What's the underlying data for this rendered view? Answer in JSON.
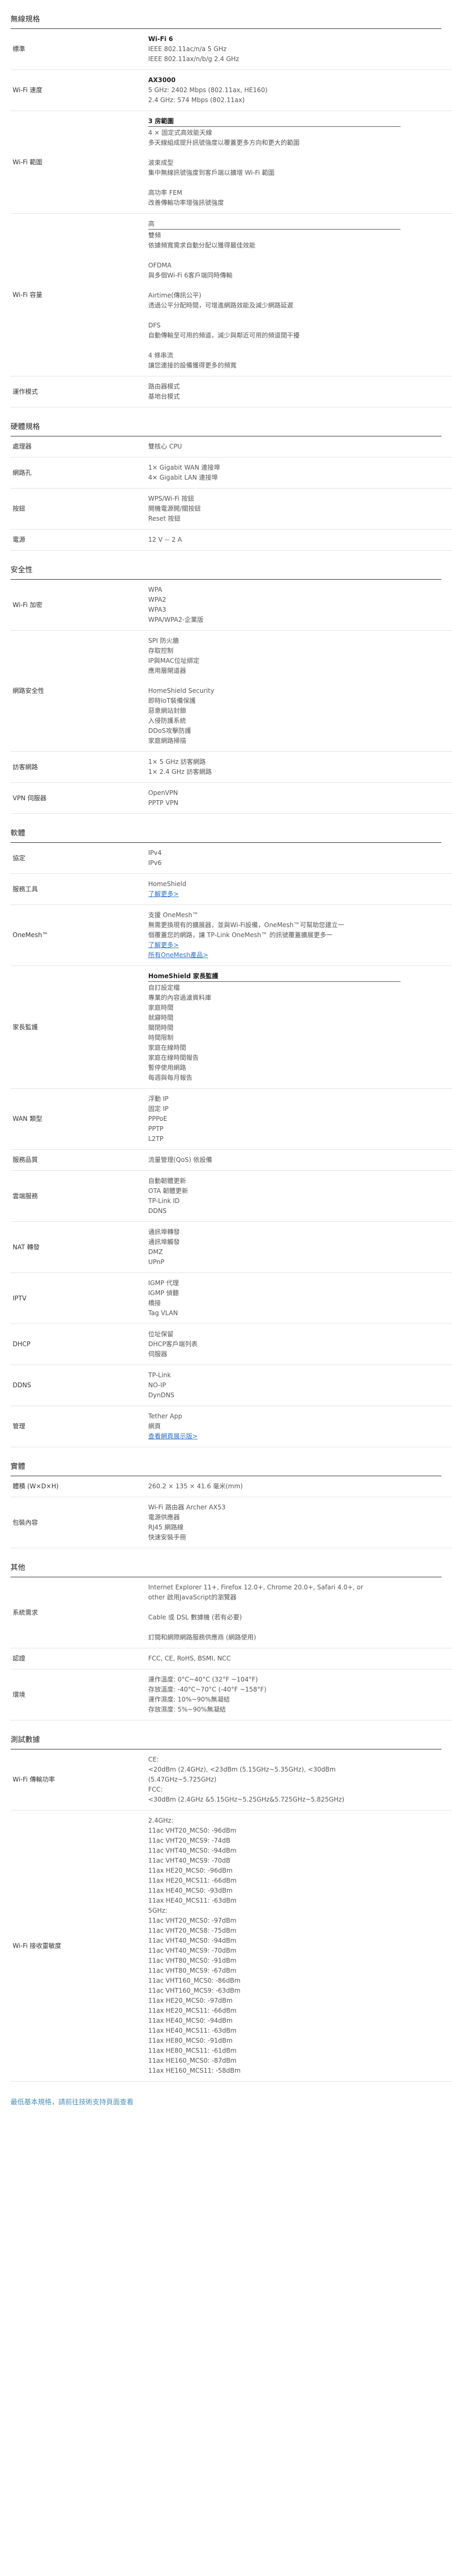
{
  "sections": [
    {
      "title": "無線規格",
      "rows": [
        {
          "key": "標準",
          "lines": [
            {
              "t": "Wi-Fi 6",
              "b": true
            },
            {
              "t": "IEEE 802.11ac/n/a 5 GHz"
            },
            {
              "t": "IEEE 802.11ax/n/b/g 2.4 GHz"
            }
          ]
        },
        {
          "key": "Wi-Fi 速度",
          "lines": [
            {
              "t": "AX3000",
              "b": true
            },
            {
              "t": "5 GHz: 2402 Mbps (802.11ax, HE160)"
            },
            {
              "t": "2.4 GHz: 574 Mbps (802.11ax)"
            }
          ]
        },
        {
          "key": "Wi-Fi 範圍",
          "lines": [
            {
              "t": "3 房範圍",
              "b": true,
              "u": true
            },
            {
              "t": "4 × 固定式高效能天線"
            },
            {
              "t": "多天線組成提升訊號強度以覆蓋更多方向和更大的範圍"
            },
            {
              "t": ""
            },
            {
              "t": "波束成型"
            },
            {
              "t": "集中無線訊號強度到客戶端以擴增 Wi-Fi 範圍"
            },
            {
              "t": ""
            },
            {
              "t": "高功率 FEM"
            },
            {
              "t": "改善傳輸功率增強訊號強度"
            }
          ]
        },
        {
          "key": "Wi-Fi 容量",
          "lines": [
            {
              "t": "高",
              "u": true
            },
            {
              "t": "雙頻"
            },
            {
              "t": "依據頻寬需求自動分配以獲得最佳效能"
            },
            {
              "t": ""
            },
            {
              "t": "OFDMA"
            },
            {
              "t": "與多個Wi-Fi 6客戶端同時傳輸"
            },
            {
              "t": ""
            },
            {
              "t": "Airtime(傳訊公平)"
            },
            {
              "t": "透過公平分配時間，可增進網路效能及減少網路延遲"
            },
            {
              "t": ""
            },
            {
              "t": "DFS"
            },
            {
              "t": "自動傳輸至可用的頻道，減少與鄰近可用的頻道間干擾"
            },
            {
              "t": ""
            },
            {
              "t": "4 條串流"
            },
            {
              "t": "讓您連接的設備獲得更多的頻寬"
            }
          ]
        },
        {
          "key": "運作模式",
          "lines": [
            {
              "t": "路由器模式"
            },
            {
              "t": "基地台模式"
            }
          ]
        }
      ]
    },
    {
      "title": "硬體規格",
      "rows": [
        {
          "key": "處理器",
          "lines": [
            {
              "t": "雙核心 CPU"
            }
          ]
        },
        {
          "key": "網路孔",
          "lines": [
            {
              "t": "1× Gigabit WAN 連接埠"
            },
            {
              "t": "4× Gigabit LAN 連接埠"
            }
          ]
        },
        {
          "key": "按鈕",
          "lines": [
            {
              "t": "WPS/Wi-Fi 按鈕"
            },
            {
              "t": "開機電源開/關按鈕"
            },
            {
              "t": "Reset 按鈕"
            }
          ]
        },
        {
          "key": "電源",
          "lines": [
            {
              "t": "12 V ⎓ 2 A"
            }
          ]
        }
      ]
    },
    {
      "title": "安全性",
      "rows": [
        {
          "key": "Wi-Fi 加密",
          "lines": [
            {
              "t": "WPA"
            },
            {
              "t": "WPA2"
            },
            {
              "t": "WPA3"
            },
            {
              "t": "WPA/WPA2-企業版"
            }
          ]
        },
        {
          "key": "網路安全性",
          "lines": [
            {
              "t": "SPI 防火牆"
            },
            {
              "t": "存取控制"
            },
            {
              "t": "IP與MAC位址綁定"
            },
            {
              "t": "應用層閘道器"
            },
            {
              "t": ""
            },
            {
              "t": "HomeShield Security"
            },
            {
              "t": "即時IoT裝備保護"
            },
            {
              "t": "惡意網站封鎖"
            },
            {
              "t": "入侵防護系統"
            },
            {
              "t": "DDoS攻擊防護"
            },
            {
              "t": "家庭網路掃描"
            }
          ]
        },
        {
          "key": "訪客網路",
          "lines": [
            {
              "t": "1× 5 GHz 訪客網路"
            },
            {
              "t": "1× 2.4 GHz 訪客網路"
            }
          ]
        },
        {
          "key": "VPN 伺服器",
          "lines": [
            {
              "t": "OpenVPN"
            },
            {
              "t": "PPTP VPN"
            }
          ]
        }
      ]
    },
    {
      "title": "軟體",
      "rows": [
        {
          "key": "協定",
          "lines": [
            {
              "t": "IPv4"
            },
            {
              "t": "IPv6"
            }
          ]
        },
        {
          "key": "服務工具",
          "lines": [
            {
              "t": "HomeShield"
            },
            {
              "t": "了解更多>",
              "link": true
            }
          ]
        },
        {
          "key": "OneMesh™",
          "lines": [
            {
              "t": "支援 OneMesh™"
            },
            {
              "t": "無需更換現有的擴展器，並與Wi-Fi設備，OneMesh™可幫助您建立一"
            },
            {
              "t": "個覆蓋您的網路，讓 TP-Link OneMesh™ 的訊號覆蓋擴展更多一"
            },
            {
              "t": "了解更多>",
              "link": true
            },
            {
              "t": "所有OneMesh產品>",
              "link": true
            }
          ]
        },
        {
          "key": "家長監護",
          "lines": [
            {
              "t": "HomeShield 家長監護",
              "b": true,
              "u": true
            },
            {
              "t": "自訂設定檔"
            },
            {
              "t": "專業的內容過濾資料庫"
            },
            {
              "t": "家庭時間"
            },
            {
              "t": "就寢時間"
            },
            {
              "t": "關閉時間"
            },
            {
              "t": "時間限制"
            },
            {
              "t": "家庭在線時間"
            },
            {
              "t": "家庭在線時間報告"
            },
            {
              "t": "暫停使用網路"
            },
            {
              "t": "每週與每月報告"
            }
          ]
        },
        {
          "key": "WAN 類型",
          "lines": [
            {
              "t": "浮動 IP"
            },
            {
              "t": "固定 IP"
            },
            {
              "t": "PPPoE"
            },
            {
              "t": "PPTP"
            },
            {
              "t": "L2TP"
            }
          ]
        },
        {
          "key": "服務品質",
          "lines": [
            {
              "t": "流量管理(QoS) 依設備"
            }
          ]
        },
        {
          "key": "雲端服務",
          "lines": [
            {
              "t": "自動韌體更新"
            },
            {
              "t": "OTA 韌體更新"
            },
            {
              "t": "TP-Link ID"
            },
            {
              "t": "DDNS"
            }
          ]
        },
        {
          "key": "NAT 轉發",
          "lines": [
            {
              "t": "通訊埠轉發"
            },
            {
              "t": "通訊埠觸發"
            },
            {
              "t": "DMZ"
            },
            {
              "t": "UPnP"
            }
          ]
        },
        {
          "key": "IPTV",
          "lines": [
            {
              "t": "IGMP 代理"
            },
            {
              "t": "IGMP 偵聽"
            },
            {
              "t": "橋接"
            },
            {
              "t": "Tag VLAN"
            }
          ]
        },
        {
          "key": "DHCP",
          "lines": [
            {
              "t": "位址保留"
            },
            {
              "t": "DHCP客戶端列表"
            },
            {
              "t": "伺服器"
            }
          ]
        },
        {
          "key": "DDNS",
          "lines": [
            {
              "t": "TP-Link"
            },
            {
              "t": "NO-IP"
            },
            {
              "t": "DynDNS"
            }
          ]
        },
        {
          "key": "管理",
          "lines": [
            {
              "t": "Tether App"
            },
            {
              "t": "網頁"
            },
            {
              "t": "查看網頁展示版>",
              "link": true
            }
          ]
        }
      ]
    },
    {
      "title": "實體",
      "rows": [
        {
          "key": "體積 (W×D×H)",
          "lines": [
            {
              "t": "260.2 × 135 × 41.6 毫米(mm)"
            }
          ]
        },
        {
          "key": "包裝內容",
          "lines": [
            {
              "t": "Wi-Fi 路由器 Archer AX53"
            },
            {
              "t": "電源供應器"
            },
            {
              "t": "RJ45 網路線"
            },
            {
              "t": "快速安裝手冊"
            }
          ]
        }
      ]
    },
    {
      "title": "其他",
      "rows": [
        {
          "key": "系統需求",
          "lines": [
            {
              "t": "Internet Explorer 11+, Firefox 12.0+, Chrome 20.0+, Safari 4.0+, or"
            },
            {
              "t": "other 啟用JavaScript的瀏覽器"
            },
            {
              "t": ""
            },
            {
              "t": "Cable 或 DSL 數據機 (若有必要)"
            },
            {
              "t": ""
            },
            {
              "t": "訂閱和網際網路服務供應商 (網路使用)"
            }
          ]
        },
        {
          "key": "認證",
          "lines": [
            {
              "t": "FCC, CE, RoHS, BSMI, NCC"
            }
          ]
        },
        {
          "key": "環境",
          "lines": [
            {
              "t": "運作溫度: 0°C~40°C (32°F ~104°F)"
            },
            {
              "t": "存放溫度: -40°C~70°C (-40°F ~158°F)"
            },
            {
              "t": "運作濕度: 10%~90%無凝結"
            },
            {
              "t": "存放濕度: 5%~90%無凝結"
            }
          ]
        }
      ]
    },
    {
      "title": "測試數據",
      "rows": [
        {
          "key": "Wi-Fi 傳輸功率",
          "lines": [
            {
              "t": "CE:"
            },
            {
              "t": "<20dBm (2.4GHz), <23dBm (5.15GHz~5.35GHz), <30dBm"
            },
            {
              "t": "(5.47GHz~5.725GHz)"
            },
            {
              "t": "FCC:"
            },
            {
              "t": "<30dBm (2.4GHz &5.15GHz~5.25GHz&5.725GHz~5.825GHz)"
            }
          ]
        },
        {
          "key": "Wi-Fi 接收靈敏度",
          "lines": [
            {
              "t": "2.4GHz:"
            },
            {
              "t": "11ac VHT20_MCS0: -96dBm"
            },
            {
              "t": "11ac VHT20_MCS9: -74dB"
            },
            {
              "t": "11ac VHT40_MCS0: -94dBm"
            },
            {
              "t": "11ac VHT40_MCS9: -70dB"
            },
            {
              "t": "11ax HE20_MCS0: -96dBm"
            },
            {
              "t": "11ax HE20_MCS11: -66dBm"
            },
            {
              "t": "11ax HE40_MCS0: -93dBm"
            },
            {
              "t": "11ax HE40_MCS11: -63dBm"
            },
            {
              "t": "5GHz:"
            },
            {
              "t": "11ac VHT20_MCS0: -97dBm"
            },
            {
              "t": "11ac VHT20_MCS8: -75dBm"
            },
            {
              "t": "11ac VHT40_MCS0: -94dBm"
            },
            {
              "t": "11ac VHT40_MCS9: -70dBm"
            },
            {
              "t": "11ac VHT80_MCS0: -91dBm"
            },
            {
              "t": "11ac VHT80_MCS9: -67dBm"
            },
            {
              "t": "11ac VHT160_MCS0: -86dBm"
            },
            {
              "t": "11ac VHT160_MCS9: -63dBm"
            },
            {
              "t": "11ax HE20_MCS0: -97dBm"
            },
            {
              "t": "11ax HE20_MCS11: -66dBm"
            },
            {
              "t": "11ax HE40_MCS0: -94dBm"
            },
            {
              "t": "11ax HE40_MCS11: -63dBm"
            },
            {
              "t": "11ax HE80_MCS0: -91dBm"
            },
            {
              "t": "11ax HE80_MCS11: -61dBm"
            },
            {
              "t": "11ax HE160_MCS0: -87dBm"
            },
            {
              "t": "11ax HE160_MCS11: -58dBm"
            }
          ]
        }
      ]
    }
  ],
  "footer": "最低基本規格，請前往技術支持頁面查看"
}
